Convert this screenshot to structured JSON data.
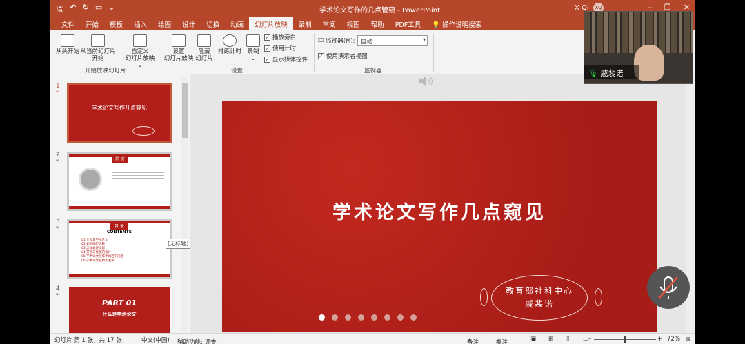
{
  "titlebar": {
    "title": "学术论文写作的几点管窥 - PowerPoint",
    "user": "X Qi",
    "avatar": "XQ",
    "qa_icons": [
      "save-icon",
      "undo-icon",
      "redo-icon",
      "present-icon",
      "customize-icon"
    ]
  },
  "tabs": [
    "文件",
    "开始",
    "模板",
    "插入",
    "绘图",
    "设计",
    "切换",
    "动画",
    "幻灯片放映",
    "录制",
    "审阅",
    "视图",
    "帮助",
    "PDF工具",
    "操作说明搜索"
  ],
  "active_tab": "幻灯片放映",
  "ribbon": {
    "from_start": "从头开始",
    "from_current_1": "从当前幻灯片",
    "from_current_2": "开始",
    "custom_1": "自定义",
    "custom_2": "幻灯片放映 ⌄",
    "group_start": "开始放映幻灯片",
    "setup_1": "设置",
    "setup_2": "幻灯片放映",
    "hide_1": "隐藏",
    "hide_2": "幻灯片",
    "rehearse": "排练计时",
    "record_1": "录制",
    "record_2": "⌄",
    "chk_narration": "播放旁白",
    "chk_timing": "使用计时",
    "chk_media": "显示媒体控件",
    "group_setup": "设置",
    "monitor_label": "监视器(M):",
    "monitor_value": "自动",
    "chk_presenter": "使用演示者视图",
    "group_monitor": "监视器"
  },
  "thumbnails": [
    {
      "num": "1",
      "title": "学术论文写作几点窥见"
    },
    {
      "num": "2",
      "title": "前 言"
    },
    {
      "num": "3",
      "title": "目 录",
      "subtitle": "CONTENTS",
      "items": [
        "01 什么是学术论文",
        "02 如何确定选题",
        "03 怎样做好文献",
        "04 开题与框架的设计",
        "05 学术论文写作中的若干问题",
        "06 学术论文投稿和发表"
      ]
    },
    {
      "num": "4",
      "title": "PART 01",
      "subtitle": "什么是学术论文"
    }
  ],
  "tooltip": "[无标题]",
  "slide": {
    "title": "学术论文写作几点窥见",
    "author_line1": "教育部社科中心",
    "author_line2": "戚裴诺"
  },
  "webcam": {
    "name": "戚裴诺"
  },
  "statusbar": {
    "slide_info": "幻灯片 第 1 张，共 17 张",
    "language": "中文(中国)",
    "accessibility": "辅助功能: 调查",
    "notes": "备注",
    "comments": "批注",
    "zoom": "72%"
  },
  "colors": {
    "accent": "#b7472a",
    "slide_red": "#b21f1a"
  }
}
